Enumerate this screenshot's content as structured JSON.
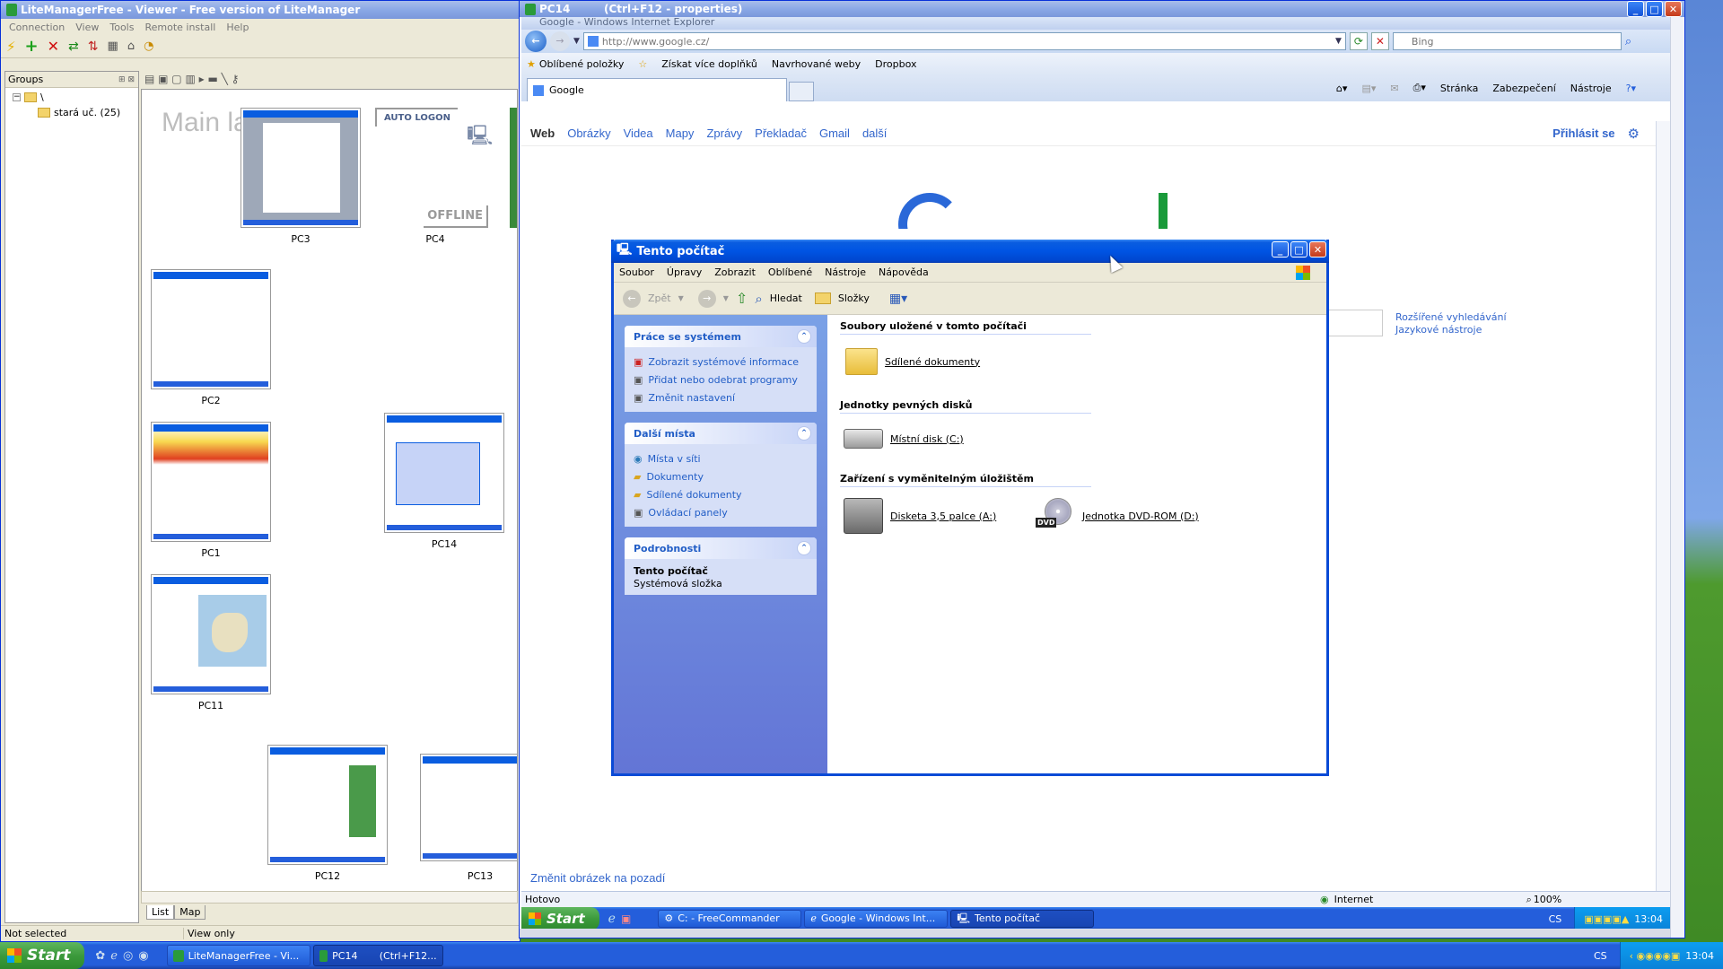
{
  "lm": {
    "title": "LiteManagerFree - Viewer - Free version of LiteManager",
    "menu": [
      "Connection",
      "View",
      "Tools",
      "Remote install",
      "Help"
    ],
    "groups_label": "Groups",
    "tree_root": "\\",
    "tree_child": "stará uč. (25)",
    "main_label": "Main la",
    "auto_logon": "AUTO LOGON",
    "offline": "OFFLINE",
    "pcs": [
      "PC3",
      "PC4",
      "PC2",
      "PC1",
      "PC14",
      "PC11",
      "PC12",
      "PC13"
    ],
    "tabs": [
      "List",
      "Map"
    ],
    "status_left": "Not selected",
    "status_mid": "View only"
  },
  "pc14": {
    "title": "PC14",
    "props": "(Ctrl+F12 - properties)"
  },
  "ie": {
    "title": "Google - Windows Internet Explorer",
    "address": "http://www.google.cz/",
    "search_placeholder": "Bing",
    "favorites": "Oblíbené položky",
    "fav_items": [
      "Získat více doplňků",
      "Navrhované weby",
      "Dropbox"
    ],
    "tab": "Google",
    "cmd": [
      "Stránka",
      "Zabezpečení",
      "Nástroje"
    ],
    "gbar": [
      "Web",
      "Obrázky",
      "Videa",
      "Mapy",
      "Zprávy",
      "Překladač",
      "Gmail",
      "další"
    ],
    "signin": "Přihlásit se",
    "adv_search": "Rozšířené vyhledávání",
    "lang_tools": "Jazykové nástroje",
    "change_bg": "Změnit obrázek na pozadí",
    "status": "Hotovo",
    "zone": "Internet",
    "zoom": "100%"
  },
  "remote_taskbar": {
    "start": "Start",
    "items": [
      "C: - FreeCommander",
      "Google - Windows Int...",
      "Tento počítač"
    ],
    "lang": "CS",
    "time": "13:04"
  },
  "explorer": {
    "title": "Tento počítač",
    "menu": [
      "Soubor",
      "Úpravy",
      "Zobrazit",
      "Oblíbené",
      "Nástroje",
      "Nápověda"
    ],
    "toolbar": {
      "back": "Zpět",
      "search": "Hledat",
      "folders": "Složky"
    },
    "sys_tasks": {
      "title": "Práce se systémem",
      "items": [
        "Zobrazit systémové informace",
        "Přidat nebo odebrat programy",
        "Změnit nastavení"
      ]
    },
    "other_places": {
      "title": "Další místa",
      "items": [
        "Místa v síti",
        "Dokumenty",
        "Sdílené dokumenty",
        "Ovládací panely"
      ]
    },
    "details": {
      "title": "Podrobnosti",
      "name": "Tento počítač",
      "desc": "Systémová složka"
    },
    "sec_files": "Soubory uložené v tomto počítači",
    "shared_docs": "Sdílené dokumenty",
    "sec_hdd": "Jednotky pevných disků",
    "local_disk": "Místní disk (C:)",
    "sec_removable": "Zařízení s vyměnitelným úložištěm",
    "floppy": "Disketa 3,5 palce (A:)",
    "dvd": "Jednotka DVD-ROM (D:)",
    "dvd_label": "DVD"
  },
  "local_taskbar": {
    "start": "Start",
    "items": [
      "LiteManagerFree - Vi...",
      "PC14",
      "(Ctrl+F12..."
    ],
    "lang": "CS",
    "time": "13:04"
  },
  "colors": {
    "xp_blue": "#0054e3",
    "link": "#215dc6",
    "start_green": "#3c9a3c"
  }
}
